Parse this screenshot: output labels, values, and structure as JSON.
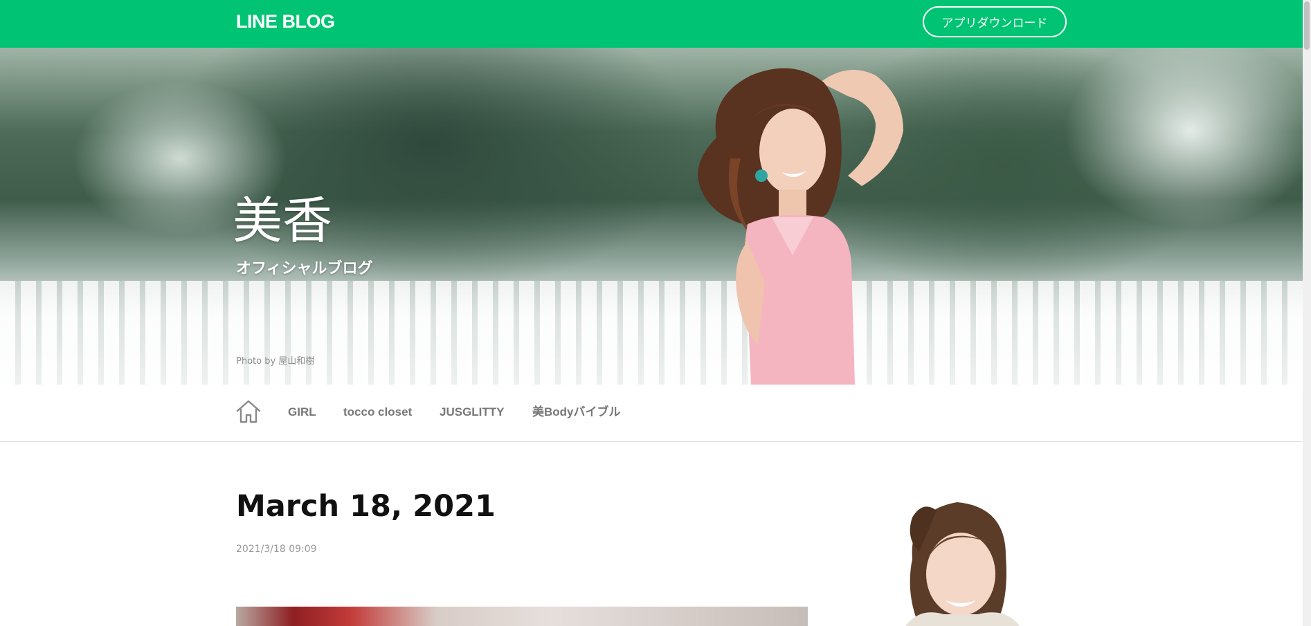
{
  "header": {
    "logo": "LINE BLOG",
    "app_download_label": "アプリダウンロード"
  },
  "hero": {
    "title": "美香",
    "subtitle": "オフィシャルブログ",
    "photo_credit": "Photo by 屋山和樹"
  },
  "nav": {
    "home_icon": "home-icon",
    "items": [
      {
        "label": "GIRL"
      },
      {
        "label": "tocco closet"
      },
      {
        "label": "JUSGLITTY"
      },
      {
        "label": "美Bodyバイブル"
      }
    ]
  },
  "post": {
    "title": "March 18, 2021",
    "datetime": "2021/3/18 09:09"
  },
  "colors": {
    "brand_green": "#00c473",
    "nav_text": "#777777",
    "date_text": "#999999"
  }
}
